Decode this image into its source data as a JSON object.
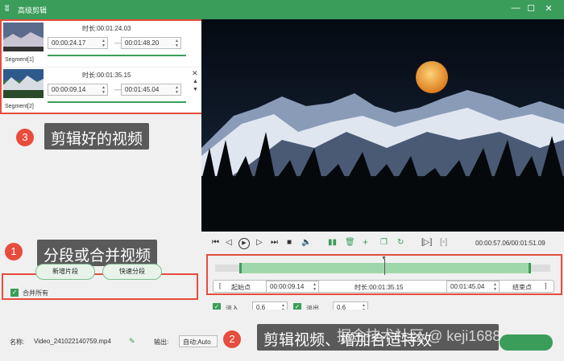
{
  "window": {
    "title": "高级剪辑",
    "logo_icon": "ʬ",
    "minimize": "—",
    "maximize": "☐",
    "close": "✕"
  },
  "segments": [
    {
      "label": "Segment[1]",
      "duration_label": "时长:",
      "duration": "00:01:24.03",
      "start": "00:00:24.17",
      "end": "00:01:48.20",
      "dash": "—"
    },
    {
      "label": "Segment[2]",
      "duration_label": "时长:",
      "duration": "00:01:35.15",
      "start": "00:00:09.14",
      "end": "00:01:45.04",
      "dash": "—"
    }
  ],
  "annotations": {
    "a3": {
      "num": "3",
      "text": "剪辑好的视频"
    },
    "a1": {
      "num": "1",
      "text": "分段或合并视频"
    },
    "a2": {
      "num": "2",
      "text": "剪辑视频、增加合适特效"
    }
  },
  "left_buttons": {
    "new_segment": "新增片段",
    "quick_split": "快速分段",
    "merge_all": "合并所有"
  },
  "player": {
    "time": "00:00:57.06/00:01:51.09"
  },
  "trim": {
    "start_bracket": "[",
    "start_label": "起始点",
    "start_value": "00:00:09.14",
    "duration_label": "时长:",
    "duration_value": "00:01:35.15",
    "end_value": "00:01:45.04",
    "end_label": "结束点",
    "end_bracket": "]"
  },
  "fade": {
    "fade_in_label": "淡入",
    "fade_in_value": "0.6",
    "fade_out_label": "淡出",
    "fade_out_value": "0.6"
  },
  "bottom": {
    "name_label": "名称:",
    "filename": "Video_241022140759.mp4",
    "output_label": "输出:",
    "output_value": "自动;Auto",
    "watermark": "掘金技术社区 @ keji1688"
  },
  "colors": {
    "accent": "#3a9e5a",
    "annotation_red": "#e74c3c"
  }
}
